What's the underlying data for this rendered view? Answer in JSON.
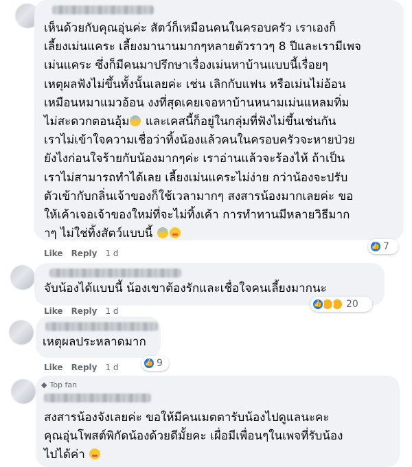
{
  "comments": [
    {
      "text": "เห็นด้วยกับคุณอุ่นค่ะ สัตว์ก็เหมือนคนในครอบครัว เราเองก็\nเลี้ยงเม่นแคระ เลี้ยงมานานมากๆหลายตัวราวๆ 8 ปีและเรามีเพจ\nเม่นแคระ ซึ่งก็มีคนมาปรึกษาเรื่องเม่นหาบ้านแบบนี้เรื่อยๆ\nเหตุผลฟังไม่ขึ้นทั้งนั้นเลยค่ะ เช่น เลิกกับแฟน หรือเม่นไม่อ้อน\nเหมือนหมาแมวอ้อน งงที่สุดเคยเจอหาบ้านหนามเม่นแหลมทิ่ม\nไม่สะดวกตอนอุ้ม",
      "text_2": " และเคสนี้ก็อยู่ในกลุ่มที่ฟังไม่ขึ้นเช่นกัน\nเราไม่เข้าใจความเชื่อว่าทิ้งน้องแล้วคนในครอบครัวจะหายป่วย\nยังไงก่อนใจร้ายกับน้องมากๆค่ะ เราอ่านแล้วจะร้องไห้ ถ้าเป็น\nเราไม่สามารถทำได้เลย เลี้ยงเม่นแคระไม่ง่าย กว่าน้องจะปรับ\nตัวเข้ากับกลิ่นเจ้าของก็ใช้เวลามากๆ สงสารน้องมากเลยค่ะ ขอ\nให้เค้าเจอเจ้าของใหม่ที่จะไม่ทิ้งเค้า การทำทานมีหลายวิธีมาก\nาๆ ไม่ใช่ทิ้งสัตว์แบบนี้",
      "reaction_count": "7",
      "like_label": "Like",
      "reply_label": "Reply",
      "timestamp": "1 d"
    },
    {
      "text": "จับน้องได้แบบนี้ น้องเขาต้องรักและเชื่อใจคนเลี้ยงมากนะ",
      "reaction_count": "20",
      "like_label": "Like",
      "reply_label": "Reply",
      "timestamp": "1 d"
    },
    {
      "text": "เหตุผลประหลาดมาก",
      "reaction_count": "9",
      "like_label": "Like",
      "reply_label": "Reply",
      "timestamp": "1 d"
    },
    {
      "badge": "Top fan",
      "text": "สงสารน้องจังเลยค่ะ ขอให้มีคนเมตตารับน้องไปดูแลนะคะ\nคุณอุ่นโพสต์พิกัดน้องด้วยดีมั้ยคะ เผื่อมีเพื่อนๆในเพจที่รับน้อง\nไปได้ค่า"
    }
  ],
  "colors": {
    "bubble": "#f0f2f5",
    "like_blue": "#1877f2",
    "meta_gray": "#65676b"
  }
}
